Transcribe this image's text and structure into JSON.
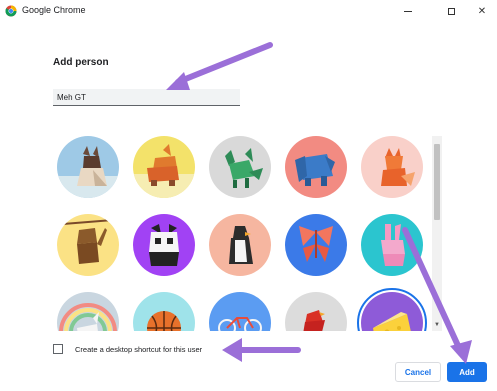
{
  "window": {
    "title": "Google Chrome",
    "minimize_icon": "minimize-icon",
    "maximize_icon": "maximize-icon",
    "close_glyph": "✕"
  },
  "dialog": {
    "heading": "Add person",
    "name_input": {
      "value": "Meh GT",
      "placeholder": ""
    },
    "avatars": [
      {
        "name": "cat",
        "bg": "#9ec9e6"
      },
      {
        "name": "corgi",
        "bg": "#f3e26a"
      },
      {
        "name": "dragon",
        "bg": "#d9d9d9"
      },
      {
        "name": "elephant",
        "bg": "#f28b82"
      },
      {
        "name": "fox",
        "bg": "#f9d0c9"
      },
      {
        "name": "monkey",
        "bg": "#fbe285"
      },
      {
        "name": "panda",
        "bg": "#a142f4"
      },
      {
        "name": "penguin",
        "bg": "#f6b6a0"
      },
      {
        "name": "butterfly",
        "bg": "#3b7ae8"
      },
      {
        "name": "rabbit",
        "bg": "#2bc5cf"
      },
      {
        "name": "unicorn",
        "bg": "#c9d6e0"
      },
      {
        "name": "basketball",
        "bg": "#9fe3ea"
      },
      {
        "name": "bike",
        "bg": "#5b9cf2"
      },
      {
        "name": "bird",
        "bg": "#dcdcdc"
      },
      {
        "name": "cheese",
        "bg": "#8e5bd8"
      }
    ],
    "desktop_shortcut": {
      "label": "Create a desktop shortcut for this user",
      "checked": false
    },
    "buttons": {
      "cancel": "Cancel",
      "add": "Add"
    }
  },
  "colors": {
    "accent": "#1a73e8",
    "annotation_arrow": "#9b6fd8"
  }
}
